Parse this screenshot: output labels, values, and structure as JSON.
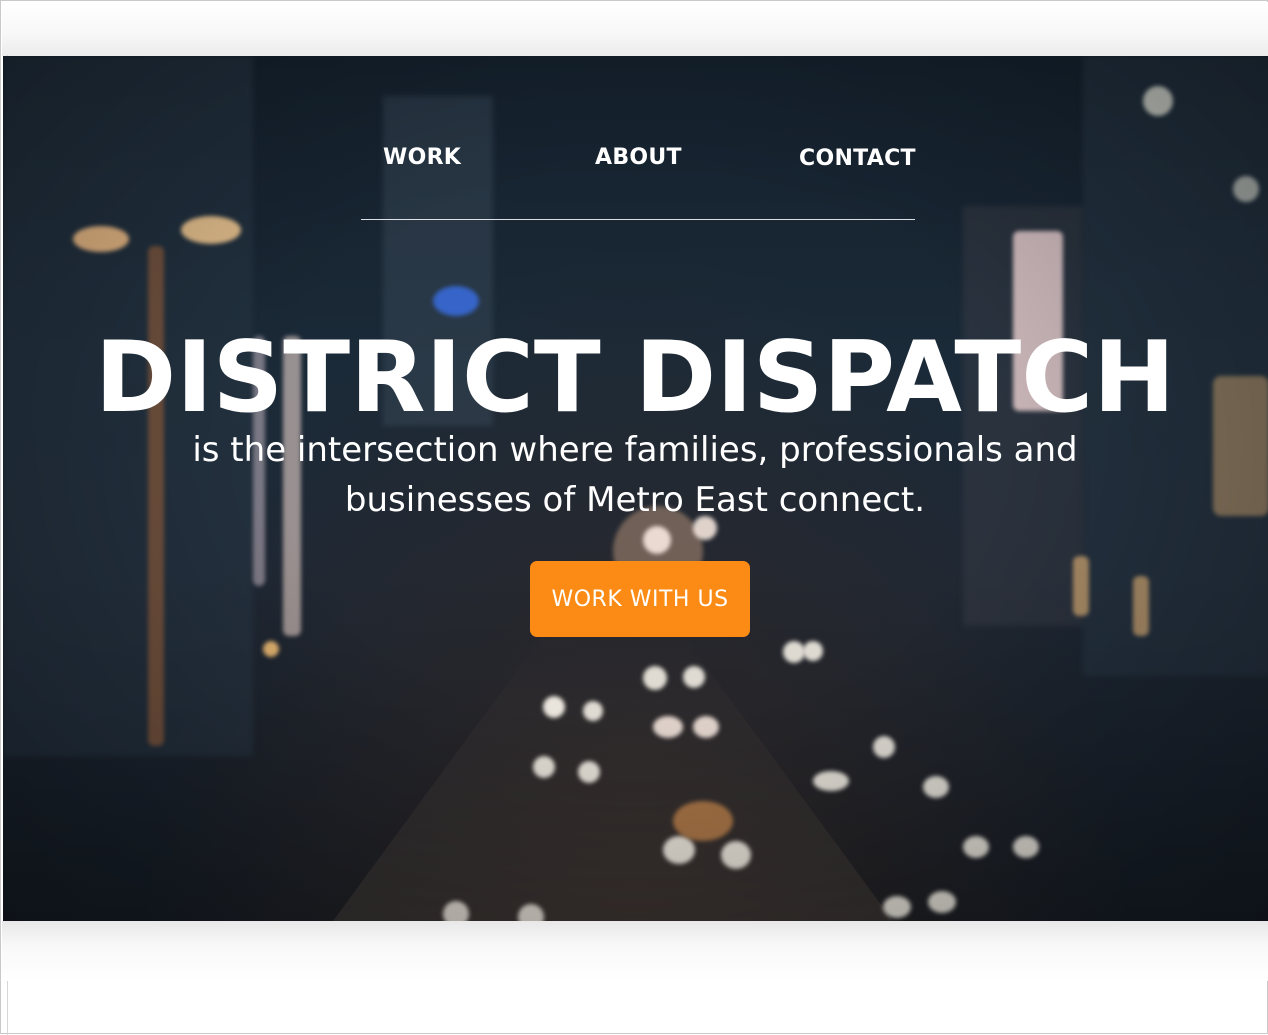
{
  "nav": {
    "items": [
      {
        "label": "WORK"
      },
      {
        "label": "ABOUT"
      },
      {
        "label": "CONTACT"
      }
    ]
  },
  "hero": {
    "title": "DISTRICT DISPATCH",
    "subtitle": "is the intersection where families, professionals and businesses of Metro East connect.",
    "cta_label": "WORK WITH US",
    "background": "blurred night city street with traffic lights"
  },
  "colors": {
    "accent": "#fb8b14",
    "text": "#ffffff",
    "hero_base": "#1b2a38"
  }
}
